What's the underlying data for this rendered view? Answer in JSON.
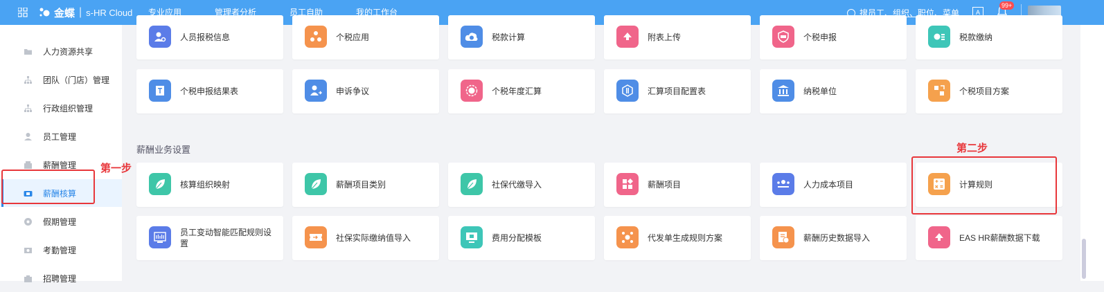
{
  "topbar": {
    "brand": "金蝶",
    "cloud": "s-HR Cloud",
    "nav": [
      "专业应用",
      "管理者分析",
      "员工自助",
      "我的工作台"
    ],
    "search_text": "搜员工、组织、职位、菜单",
    "lang_icon": "A",
    "badge": "99+",
    "color": "#4aa3f3"
  },
  "sidebar": {
    "items": [
      {
        "label": "人力资源共享",
        "icon": "folder-icon"
      },
      {
        "label": "团队（门店）管理",
        "icon": "org-icon"
      },
      {
        "label": "行政组织管理",
        "icon": "org-icon"
      },
      {
        "label": "员工管理",
        "icon": "user-icon"
      },
      {
        "label": "薪酬管理",
        "icon": "wallet-icon"
      },
      {
        "label": "薪酬核算",
        "icon": "payroll-icon",
        "active": true
      },
      {
        "label": "假期管理",
        "icon": "clock-icon"
      },
      {
        "label": "考勤管理",
        "icon": "camera-icon"
      },
      {
        "label": "招聘管理",
        "icon": "briefcase-icon"
      }
    ]
  },
  "tax_row1": [
    {
      "label": "人员报税信息",
      "color": "#5b7ce8",
      "icon": "person-gear-icon"
    },
    {
      "label": "个税应用",
      "color": "#f5934d",
      "icon": "nodes-icon"
    },
    {
      "label": "税款计算",
      "color": "#4f8de6",
      "icon": "cloud-coin-icon"
    },
    {
      "label": "附表上传",
      "color": "#f0658a",
      "icon": "upload-icon"
    },
    {
      "label": "个税申报",
      "color": "#f0658a",
      "icon": "tax-shield-icon"
    },
    {
      "label": "税款缴纳",
      "color": "#3ec6b8",
      "icon": "pay-icon"
    }
  ],
  "tax_row2": [
    {
      "label": "个税申报结果表",
      "color": "#4f8de6",
      "icon": "doc-icon"
    },
    {
      "label": "申诉争议",
      "color": "#4f8de6",
      "icon": "person-appeal-icon"
    },
    {
      "label": "个税年度汇算",
      "color": "#f0658a",
      "icon": "yen-circle-icon"
    },
    {
      "label": "汇算项目配置表",
      "color": "#4f8de6",
      "icon": "config-icon"
    },
    {
      "label": "纳税单位",
      "color": "#4f8de6",
      "icon": "bank-icon"
    },
    {
      "label": "个税项目方案",
      "color": "#f5a14d",
      "icon": "plan-icon"
    }
  ],
  "section_title": "薪酬业务设置",
  "pay_row1": [
    {
      "label": "核算组织映射",
      "color": "#3ec6a8",
      "icon": "leaf-icon"
    },
    {
      "label": "薪酬项目类别",
      "color": "#3ec6a8",
      "icon": "leaf-icon"
    },
    {
      "label": "社保代缴导入",
      "color": "#3ec6a8",
      "icon": "leaf-icon"
    },
    {
      "label": "薪酬项目",
      "color": "#f0658a",
      "icon": "blocks-icon"
    },
    {
      "label": "人力成本项目",
      "color": "#5b7ce8",
      "icon": "team-icon"
    },
    {
      "label": "计算规则",
      "color": "#f5a14d",
      "icon": "calculator-icon"
    }
  ],
  "pay_row2": [
    {
      "label": "员工变动智能匹配规则设置",
      "color": "#5b7ce8",
      "icon": "rule-icon"
    },
    {
      "label": "社保实际缴纳值导入",
      "color": "#f5934d",
      "icon": "import-icon"
    },
    {
      "label": "费用分配模板",
      "color": "#3ec6b8",
      "icon": "monitor-icon"
    },
    {
      "label": "代发单生成规则方案",
      "color": "#f5934d",
      "icon": "generate-icon"
    },
    {
      "label": "薪酬历史数据导入",
      "color": "#f5934d",
      "icon": "history-import-icon"
    },
    {
      "label": "EAS HR薪酬数据下载",
      "color": "#f0658a",
      "icon": "download-icon"
    }
  ],
  "annotations": {
    "step1": "第一步",
    "step2": "第二步",
    "color": "#e8363a"
  }
}
